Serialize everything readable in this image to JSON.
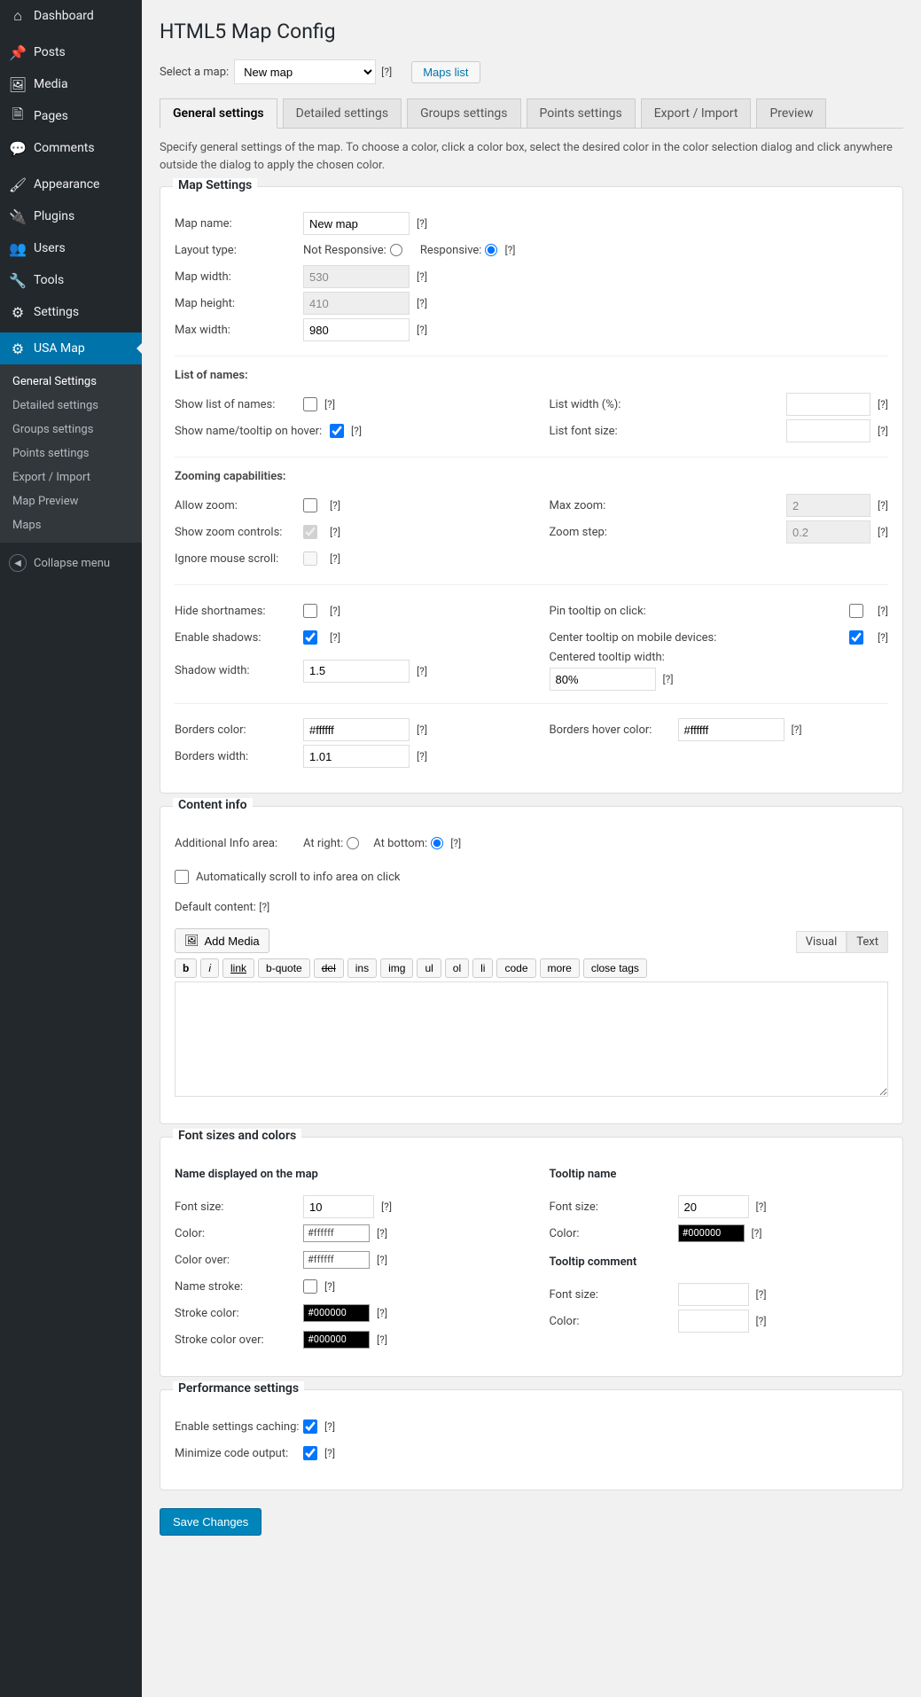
{
  "sidebar": {
    "items": [
      {
        "icon": "⌂",
        "label": "Dashboard"
      },
      {
        "icon": "📌",
        "label": "Posts"
      },
      {
        "icon": "🖼",
        "label": "Media"
      },
      {
        "icon": "🗎",
        "label": "Pages"
      },
      {
        "icon": "💬",
        "label": "Comments"
      },
      {
        "icon": "🖌",
        "label": "Appearance"
      },
      {
        "icon": "🔌",
        "label": "Plugins"
      },
      {
        "icon": "👥",
        "label": "Users"
      },
      {
        "icon": "🔧",
        "label": "Tools"
      },
      {
        "icon": "⚙",
        "label": "Settings"
      },
      {
        "icon": "⚙",
        "label": "USA Map"
      }
    ],
    "submenu": [
      "General Settings",
      "Detailed settings",
      "Groups settings",
      "Points settings",
      "Export / Import",
      "Map Preview",
      "Maps"
    ],
    "collapse": "Collapse menu"
  },
  "page": {
    "title": "HTML5 Map Config",
    "select_label": "Select a map:",
    "map_options": [
      "New map"
    ],
    "maps_list": "Maps list",
    "tabs": [
      "General settings",
      "Detailed settings",
      "Groups settings",
      "Points settings",
      "Export / Import",
      "Preview"
    ],
    "description": "Specify general settings of the map. To choose a color, click a color box, select the desired color in the color selection dialog and click anywhere outside the dialog to apply the chosen color.",
    "help": "[?]"
  },
  "map_settings": {
    "legend": "Map Settings",
    "map_name": {
      "label": "Map name:",
      "value": "New map"
    },
    "layout": {
      "label": "Layout type:",
      "not_responsive": "Not Responsive:",
      "responsive": "Responsive:"
    },
    "width": {
      "label": "Map width:",
      "value": "530"
    },
    "height": {
      "label": "Map height:",
      "value": "410"
    },
    "max_width": {
      "label": "Max width:",
      "value": "980"
    },
    "list_section": "List of names:",
    "show_list": {
      "label": "Show list of names:"
    },
    "show_name_tooltip": {
      "label": "Show name/tooltip on hover:"
    },
    "list_width": {
      "label": "List width (%):"
    },
    "list_font": {
      "label": "List font size:"
    },
    "zoom_section": "Zooming capabilities:",
    "allow_zoom": "Allow zoom:",
    "show_zoom_controls": "Show zoom controls:",
    "ignore_scroll": "Ignore mouse scroll:",
    "max_zoom": {
      "label": "Max zoom:",
      "value": "2"
    },
    "zoom_step": {
      "label": "Zoom step:",
      "value": "0.2"
    },
    "hide_short": "Hide shortnames:",
    "enable_shadows": "Enable shadows:",
    "shadow_width": {
      "label": "Shadow width:",
      "value": "1.5"
    },
    "pin_tooltip": "Pin tooltip on click:",
    "center_tooltip": "Center tooltip on mobile devices:",
    "centered_width": {
      "label": "Centered tooltip width:",
      "value": "80%"
    },
    "borders_color": {
      "label": "Borders color:",
      "value": "#ffffff"
    },
    "borders_hover": {
      "label": "Borders hover color:",
      "value": "#ffffff"
    },
    "borders_width": {
      "label": "Borders width:",
      "value": "1.01"
    }
  },
  "content_info": {
    "legend": "Content info",
    "area_label": "Additional Info area:",
    "at_right": "At right:",
    "at_bottom": "At bottom:",
    "auto_scroll": "Automatically scroll to info area on click",
    "default_content": "Default content:",
    "add_media": "Add Media",
    "visual": "Visual",
    "text": "Text",
    "editor_buttons": [
      "b",
      "i",
      "link",
      "b-quote",
      "del",
      "ins",
      "img",
      "ul",
      "ol",
      "li",
      "code",
      "more",
      "close tags"
    ]
  },
  "fonts": {
    "legend": "Font sizes and colors",
    "name_heading": "Name displayed on the map",
    "tooltip_heading": "Tooltip name",
    "tooltip_comment": "Tooltip comment",
    "font_size": "Font size:",
    "color": "Color:",
    "color_over": "Color over:",
    "name_stroke": "Name stroke:",
    "stroke_color": "Stroke color:",
    "stroke_color_over": "Stroke color over:",
    "name_font": "10",
    "name_color": "#ffffff",
    "name_color_over": "#ffffff",
    "stroke_color_v": "#000000",
    "stroke_color_over_v": "#000000",
    "tooltip_font": "20",
    "tooltip_color": "#000000"
  },
  "perf": {
    "legend": "Performance settings",
    "caching": "Enable settings caching:",
    "minimize": "Minimize code output:"
  },
  "save": "Save Changes"
}
